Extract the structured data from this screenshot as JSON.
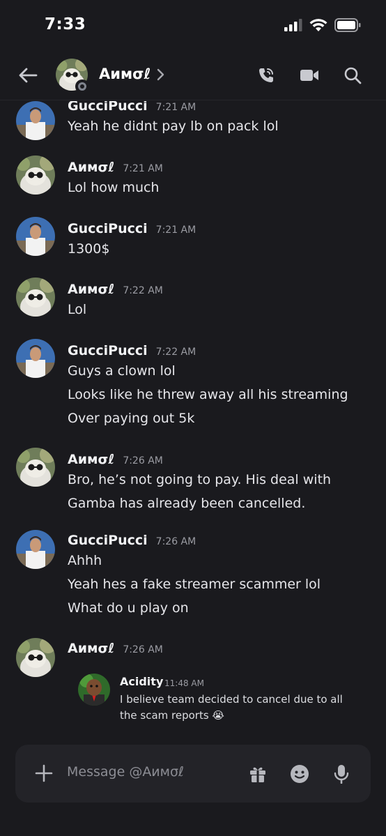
{
  "status_bar": {
    "time": "7:33"
  },
  "header": {
    "name": "Aимσℓ"
  },
  "messages": [
    {
      "author": "GucciPucci",
      "time": "7:21 AM",
      "avatar": "gucci",
      "lines": [
        "Yeah he didnt pay lb on pack lol"
      ]
    },
    {
      "author": "Aимσℓ",
      "time": "7:21 AM",
      "avatar": "cat",
      "lines": [
        "Lol how much"
      ]
    },
    {
      "author": "GucciPucci",
      "time": "7:21 AM",
      "avatar": "gucci",
      "lines": [
        "1300$"
      ]
    },
    {
      "author": "Aимσℓ",
      "time": "7:22 AM",
      "avatar": "cat",
      "lines": [
        "Lol"
      ]
    },
    {
      "author": "GucciPucci",
      "time": "7:22 AM",
      "avatar": "gucci",
      "lines": [
        "Guys a clown lol",
        "Looks like he threw away all his streaming",
        "Over paying out 5k"
      ]
    },
    {
      "author": "Aимσℓ",
      "time": "7:26 AM",
      "avatar": "cat",
      "lines": [
        "Bro, he’s not going to pay. His deal with",
        "Gamba has already been cancelled."
      ]
    },
    {
      "author": "GucciPucci",
      "time": "7:26 AM",
      "avatar": "gucci",
      "lines": [
        "Ahhh",
        "Yeah hes a fake streamer scammer lol",
        "What do u play on"
      ]
    },
    {
      "author": "Aимσℓ",
      "time": "7:26 AM",
      "avatar": "cat",
      "lines": []
    }
  ],
  "forwarded": {
    "author": "Acidity",
    "time": "11:48 AM",
    "lines": [
      "I believe team decided to cancel due to all",
      "the scam reports 😭"
    ]
  },
  "composer": {
    "placeholder": "Message @Aимσℓ"
  },
  "icons": {
    "back": "arrow-left-icon",
    "chevron": "chevron-right-icon",
    "call": "phone-call-icon",
    "video": "video-camera-icon",
    "search": "search-icon",
    "plus": "plus-icon",
    "gift": "gift-icon",
    "emoji": "emoji-icon",
    "mic": "microphone-icon"
  },
  "colors": {
    "background": "#1a1a1e",
    "composer": "#232328",
    "text": "#ececee",
    "muted": "#9b9ca3"
  }
}
